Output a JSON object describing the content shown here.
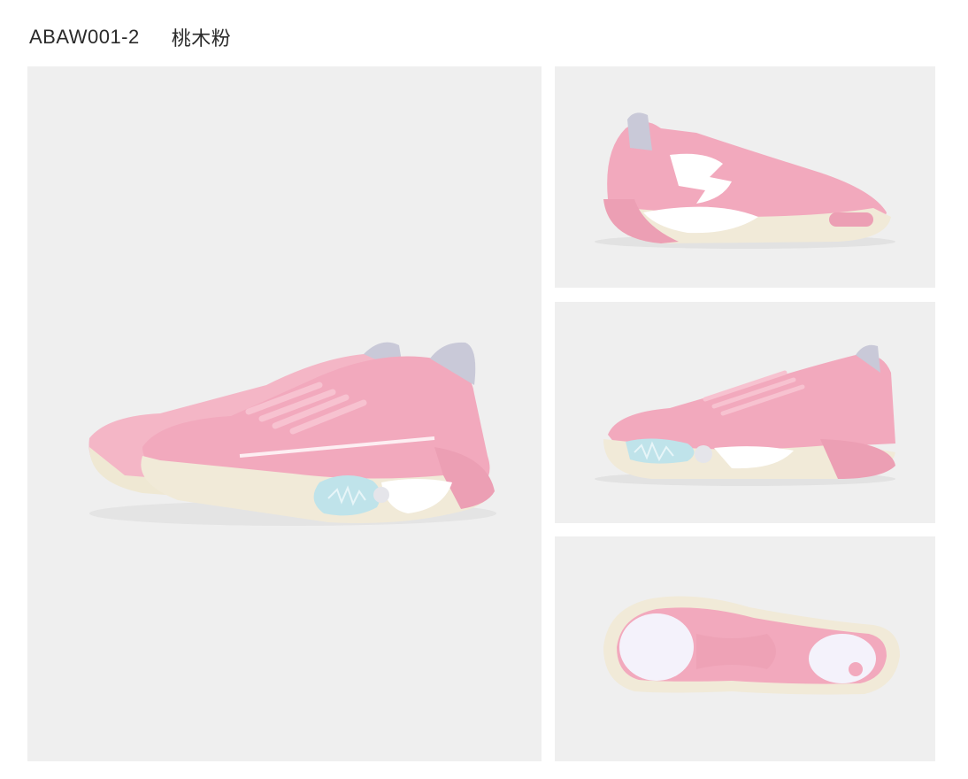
{
  "product": {
    "code": "ABAW001-2",
    "color_name": "桃木粉"
  },
  "colors": {
    "panel_bg": "#efefef",
    "upper_pink": "#f2a9bd",
    "sole_cream": "#f1ead8",
    "accent_blue": "#bfe3ea",
    "white": "#ffffff"
  },
  "views": [
    {
      "name": "main-pair-view"
    },
    {
      "name": "lateral-side-view"
    },
    {
      "name": "medial-side-view"
    },
    {
      "name": "outsole-view"
    }
  ]
}
